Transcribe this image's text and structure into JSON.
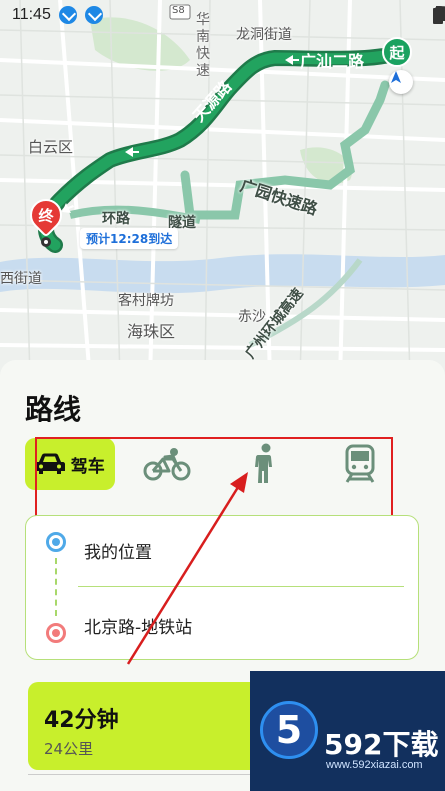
{
  "status_bar": {
    "time": "11:45"
  },
  "map": {
    "districts": [
      "白云区",
      "海珠区"
    ],
    "places": [
      "龙洞街道",
      "客村牌坊",
      "赤沙",
      "西街道"
    ],
    "road_labels": [
      "广汕二路",
      "天源路",
      "广园快速路",
      "广州环城高速",
      "环路",
      "隧道"
    ],
    "highway_badge": "S8",
    "vertical_label": "华南快速",
    "markers": {
      "start": "起",
      "end": "终"
    },
    "eta": "预计12:28到达"
  },
  "panel": {
    "title": "路线",
    "modes": [
      {
        "label": "驾车",
        "icon": "car-icon",
        "active": true
      },
      {
        "label": "",
        "icon": "bicycle-icon",
        "active": false
      },
      {
        "label": "",
        "icon": "walking-icon",
        "active": false
      },
      {
        "label": "",
        "icon": "train-icon",
        "active": false
      }
    ],
    "origin": "我的位置",
    "destination": "北京路-地铁站",
    "route": {
      "time": "42分钟",
      "distance": "24公里"
    }
  },
  "watermark": {
    "brand": "592下载",
    "url": "www.592xiazai.com",
    "logo_char": "5"
  },
  "colors": {
    "accent": "#c8ef2c",
    "route": "#1aa260",
    "highlight": "#e02020"
  }
}
